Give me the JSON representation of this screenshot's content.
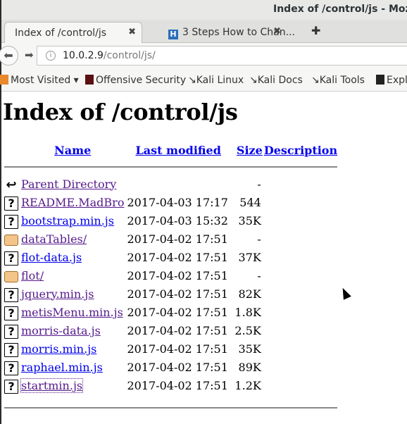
{
  "window": {
    "title": "Index of /control/js - Mozilla"
  },
  "tabs": [
    {
      "label": "Index of /control/js"
    },
    {
      "label": "3 Steps How to Chan..."
    }
  ],
  "nav": {
    "url_host": "10.0.2.9",
    "url_path": "/control/js/"
  },
  "bookmarks": [
    {
      "label": "Most Visited ▾"
    },
    {
      "label": "Offensive Security"
    },
    {
      "label": "Kali Linux"
    },
    {
      "label": "Kali Docs"
    },
    {
      "label": "Kali Tools"
    },
    {
      "label": "Expl"
    }
  ],
  "page": {
    "heading": "Index of /control/js",
    "columns": {
      "name": "Name",
      "modified": "Last modified",
      "size": "Size",
      "description": "Description"
    },
    "rows": [
      {
        "icon": "back-icon",
        "name": "Parent Directory",
        "modified": "",
        "size": "-",
        "visited": true
      },
      {
        "icon": "unknown-file-icon",
        "name": "README.MadBro",
        "modified": "2017-04-03 17:17",
        "size": "544",
        "visited": true
      },
      {
        "icon": "unknown-file-icon",
        "name": "bootstrap.min.js",
        "modified": "2017-04-03 15:32",
        "size": "35K",
        "visited": false
      },
      {
        "icon": "folder-icon",
        "name": "dataTables/",
        "modified": "2017-04-02 17:51",
        "size": "-",
        "visited": true
      },
      {
        "icon": "unknown-file-icon",
        "name": "flot-data.js",
        "modified": "2017-04-02 17:51",
        "size": "37K",
        "visited": false
      },
      {
        "icon": "folder-icon",
        "name": "flot/",
        "modified": "2017-04-02 17:51",
        "size": "-",
        "visited": true
      },
      {
        "icon": "unknown-file-icon",
        "name": "jquery.min.js",
        "modified": "2017-04-02 17:51",
        "size": "82K",
        "visited": true
      },
      {
        "icon": "unknown-file-icon",
        "name": "metisMenu.min.js",
        "modified": "2017-04-02 17:51",
        "size": "1.8K",
        "visited": true
      },
      {
        "icon": "unknown-file-icon",
        "name": "morris-data.js",
        "modified": "2017-04-02 17:51",
        "size": "2.5K",
        "visited": true
      },
      {
        "icon": "unknown-file-icon",
        "name": "morris.min.js",
        "modified": "2017-04-02 17:51",
        "size": "35K",
        "visited": false
      },
      {
        "icon": "unknown-file-icon",
        "name": "raphael.min.js",
        "modified": "2017-04-02 17:51",
        "size": "89K",
        "visited": false
      },
      {
        "icon": "unknown-file-icon",
        "name": "startmin.js",
        "modified": "2017-04-02 17:51",
        "size": "1.2K",
        "visited": true
      }
    ]
  },
  "colors": {
    "link": "#0000ee",
    "visited": "#551a8b"
  }
}
